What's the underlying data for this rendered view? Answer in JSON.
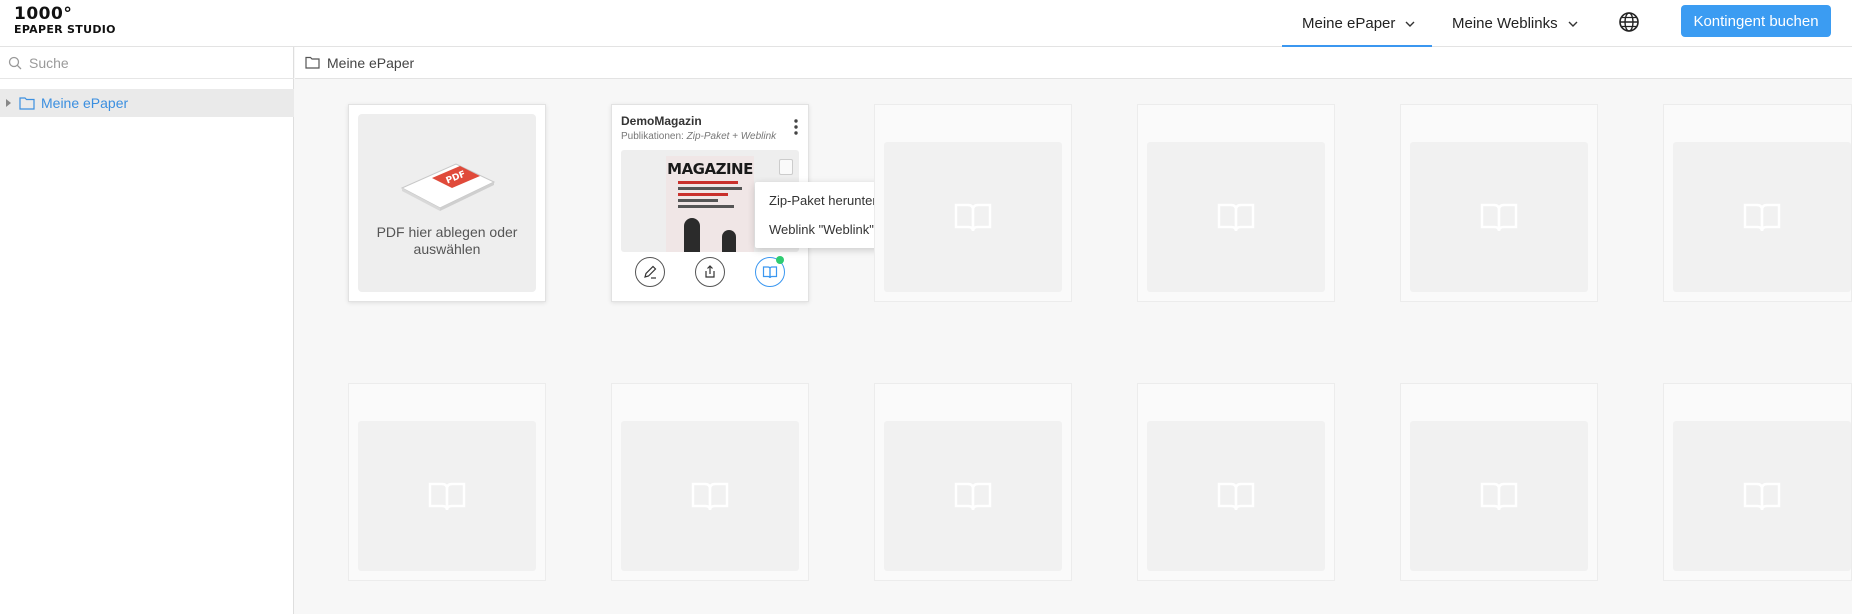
{
  "header": {
    "logo_top": "1000°",
    "logo_bottom": "EPAPER STUDIO",
    "nav": [
      {
        "label": "Meine ePaper"
      },
      {
        "label": "Meine Weblinks"
      }
    ],
    "cta_label": "Kontingent buchen"
  },
  "sidebar": {
    "search_placeholder": "Suche",
    "tree": [
      {
        "label": "Meine ePaper"
      }
    ]
  },
  "breadcrumb": {
    "label": "Meine ePaper"
  },
  "upload": {
    "text": "PDF hier ablegen oder auswählen",
    "pdf_label": "PDF"
  },
  "demo": {
    "title": "DemoMagazin",
    "subtitle_prefix": "Publikationen:",
    "subtitle_value": "Zip-Paket + Weblink",
    "cover_title": "MAGAZINE"
  },
  "dropdown": {
    "items": [
      {
        "label": "Zip-Paket herunterladen"
      },
      {
        "label": "Weblink \"Weblink\" anzeigen"
      }
    ]
  },
  "colors": {
    "accent": "#3b97f0",
    "status_dot": "#2ecc71"
  }
}
